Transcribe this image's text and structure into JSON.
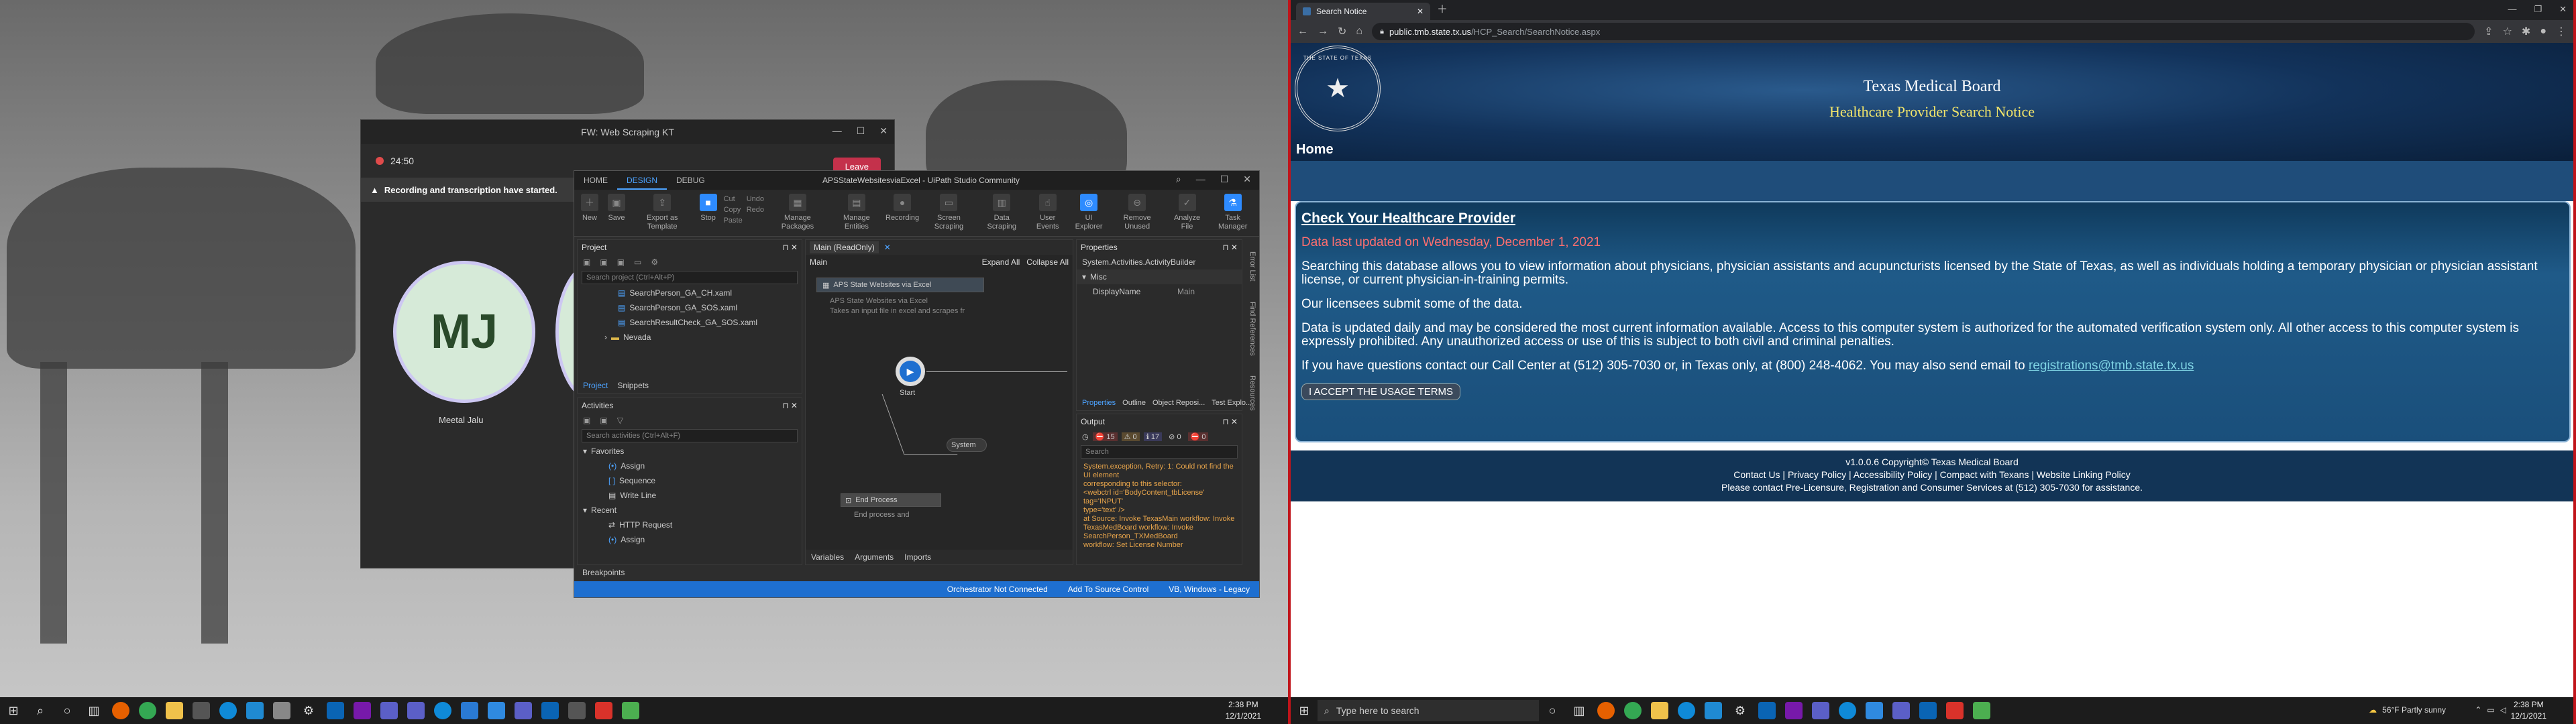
{
  "teams": {
    "title": "FW: Web Scraping KT",
    "timer": "24:50",
    "leave_label": "Leave",
    "banner": "Recording and transcription have started.",
    "participant_initials": "MJ",
    "participant_name": "Meetal Jalu"
  },
  "uipath": {
    "tabs": [
      "HOME",
      "DESIGN",
      "DEBUG"
    ],
    "window_title": "APSStateWebsitesviaExcel - UiPath Studio Community",
    "ribbon": [
      "New",
      "Save",
      "Export as Template",
      "Stop",
      "Cut",
      "Copy",
      "Paste",
      "Undo",
      "Redo",
      "Manage Packages",
      "Manage Entities",
      "Recording",
      "Screen Scraping",
      "Data Scraping",
      "User Events",
      "UI Explorer",
      "Remove Unused",
      "Analyze File",
      "Task Manager"
    ],
    "project_panel_title": "Project",
    "project_search": "Search project (Ctrl+Alt+P)",
    "project_files": [
      "SearchPerson_GA_CH.xaml",
      "SearchPerson_GA_SOS.xaml",
      "SearchResultCheck_GA_SOS.xaml",
      "Nevada"
    ],
    "project_tabs": [
      "Project",
      "Snippets"
    ],
    "activities_title": "Activities",
    "activities_search": "Search activities (Ctrl+Alt+F)",
    "favorites_label": "Favorites",
    "favorites": [
      "Assign",
      "Sequence",
      "Write Line"
    ],
    "recent_label": "Recent",
    "recent": [
      "HTTP Request",
      "Assign"
    ],
    "designer_tab": "Main (ReadOnly)",
    "designer_crumb": "Main",
    "expand_all": "Expand All",
    "collapse_all": "Collapse All",
    "flow_title": "APS State Websites via Excel",
    "flow_desc": "APS State Websites via Excel",
    "flow_desc2": "Takes an input file in excel and scrapes fr",
    "start_label": "Start",
    "system_label": "System",
    "end_title": "End Process",
    "end_desc": "End process and",
    "designer_bottom_tabs": [
      "Variables",
      "Arguments",
      "Imports"
    ],
    "props_title": "Properties",
    "props_type": "System.Activities.ActivityBuilder",
    "props_group": "Misc",
    "props_key": "DisplayName",
    "props_value": "Main",
    "props_tabs": [
      "Properties",
      "Outline",
      "Object Reposi...",
      "Test Explo..."
    ],
    "output_title": "Output",
    "output_counts": [
      "15",
      "0",
      "17",
      "0",
      "0"
    ],
    "output_search": "Search",
    "output_lines": [
      "System.exception, Retry: 1: Could not find the UI element",
      "corresponding to this selector:",
      "<webctrl id='BodyContent_tbLicense' tag='INPUT'",
      "type='text' />",
      " at Source: Invoke TexasMain workflow: Invoke",
      "TexasMedBoard workflow: Invoke SearchPerson_TXMedBoard",
      "workflow: Set License Number"
    ],
    "breakpoints": "Breakpoints",
    "side_tabs": [
      "Error List",
      "Find References",
      "Resources"
    ],
    "status": [
      "Orchestrator Not Connected",
      "Add To Source Control",
      "VB, Windows - Legacy"
    ]
  },
  "chrome": {
    "tab_title": "Search Notice",
    "url_host": "public.tmb.state.tx.us",
    "url_path": "/HCP_Search/SearchNotice.aspx"
  },
  "tmb": {
    "seal_text": "THE STATE OF TEXAS",
    "title": "Texas Medical Board",
    "subtitle": "Healthcare Provider Search Notice",
    "home": "Home",
    "heading": "Check Your Healthcare Provider",
    "updated": "Data last updated on Wednesday, December 1, 2021",
    "p1": "Searching this database allows you to view information about physicians, physician assistants and acupuncturists licensed by the State of Texas, as well as individuals holding a temporary physician or physician assistant license, or current physician-in-training permits.",
    "p2": "Our licensees submit some of the data.",
    "p3": "Data is updated daily and may be considered the most current information available. Access to this computer system is authorized for the automated verification system only. All other access to this computer system is expressly prohibited. Any unauthorized access or use of this is subject to both civil and criminal penalties.",
    "p4": "If you have questions contact our Call Center at (512) 305-7030 or, in Texas only, at (800) 248-4062. You may also send email to",
    "email": "registrations@tmb.state.tx.us",
    "accept": "I ACCEPT THE USAGE TERMS",
    "version": "v1.0.0.6 Copyright© Texas Medical Board",
    "footer_links": [
      "Contact Us",
      "Privacy Policy",
      "Accessibility Policy",
      "Compact with Texans",
      "Website Linking Policy"
    ],
    "footer_note": "Please contact Pre-Licensure, Registration and Consumer Services at (512) 305-7030 for assistance."
  },
  "taskbar_left": {
    "time": "2:38 PM",
    "date": "12/1/2021"
  },
  "taskbar_right": {
    "search": "Type here to search",
    "weather": "56°F  Partly sunny",
    "time": "2:38 PM",
    "date": "12/1/2021"
  },
  "colors": {
    "teams_leave": "#c4314b",
    "uipath_accent": "#2e8bff",
    "tmb_yellow": "#f2e56a",
    "tmb_red": "#ff6f6f"
  }
}
